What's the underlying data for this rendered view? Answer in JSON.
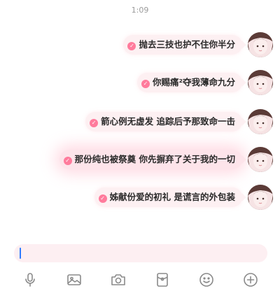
{
  "status_bar": {
    "time": "1:09"
  },
  "messages": [
    {
      "text": "抛去三技也护不住你半分"
    },
    {
      "text": "你赐痛²夺我薄命九分"
    },
    {
      "text": "箭心例无虚发 追踪后予那致命一击"
    },
    {
      "text": "那份纯也被祭奠 你先摒弃了关于我的一切"
    },
    {
      "text": "姊献份爱的初礼 是谎言的外包装"
    }
  ],
  "composer": {
    "value": ""
  },
  "toolbar": {
    "icons": [
      "microphone-icon",
      "image-icon",
      "camera-icon",
      "red-packet-icon",
      "emoji-icon",
      "plus-icon"
    ]
  },
  "colors": {
    "bubble": "#fdf0f2",
    "read_check": "#ff7b9c",
    "composer": "#fdeff2",
    "caret": "#2f7bff",
    "icon": "#8a8a8a"
  }
}
